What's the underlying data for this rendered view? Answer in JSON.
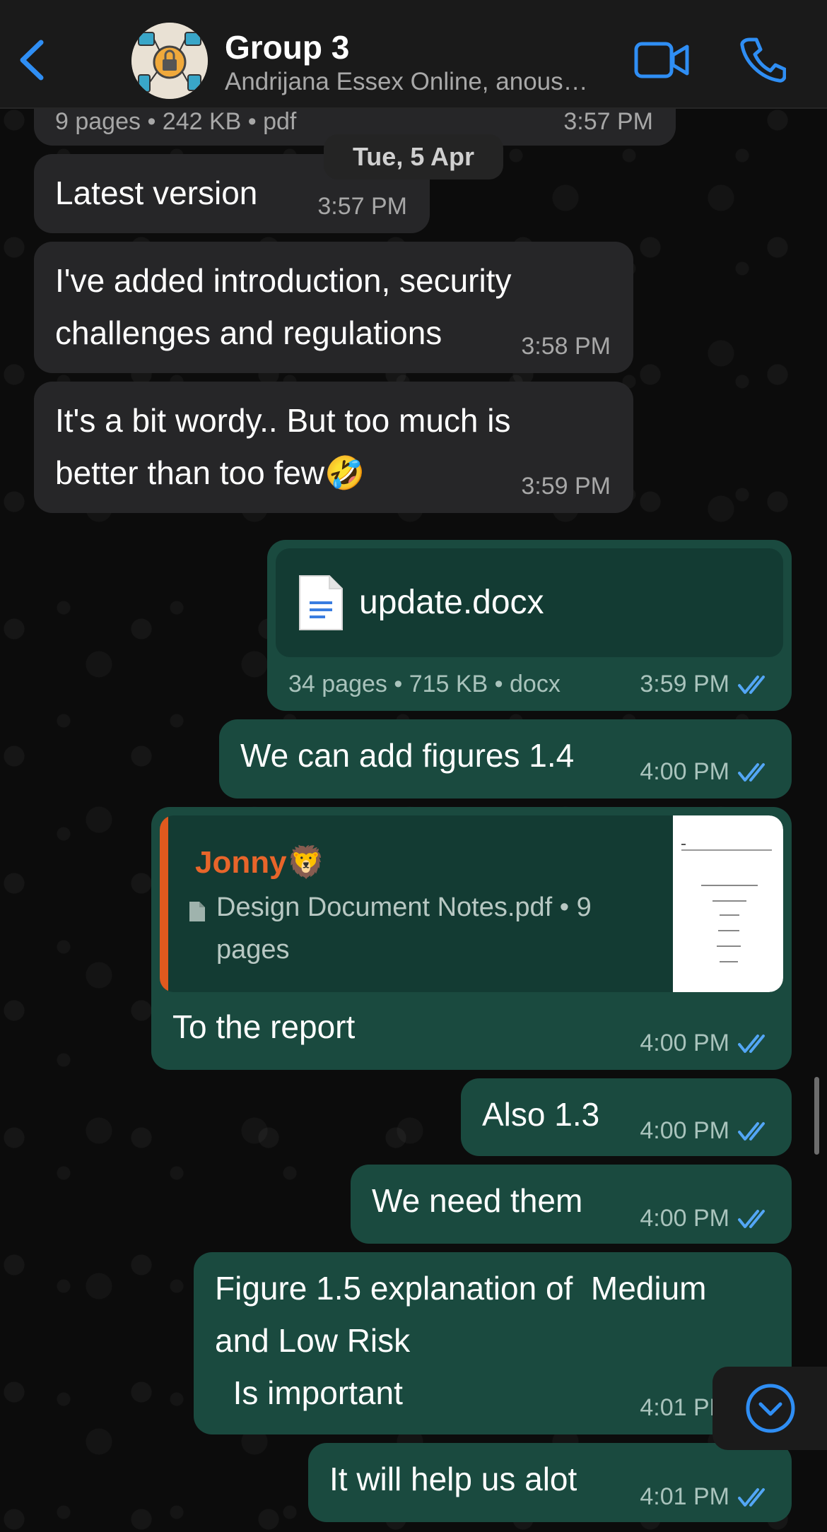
{
  "header": {
    "title": "Group 3",
    "subtitle": "Andrijana Essex Online, anous…"
  },
  "date_pill": "Tue, 5 Apr",
  "messages": {
    "m0": {
      "meta": "9 pages • 242 KB • pdf",
      "time": "3:57 PM"
    },
    "m1": {
      "text": "Latest version",
      "time": "3:57 PM"
    },
    "m2": {
      "text": "I've added introduction, security\nchallenges and regulations",
      "time": "3:58 PM"
    },
    "m3": {
      "text": "It's a bit wordy.. But too much is\nbetter than too few🤣",
      "time": "3:59 PM"
    },
    "m4": {
      "filename": "update.docx",
      "meta": "34 pages • 715 KB • docx",
      "time": "3:59 PM"
    },
    "m5": {
      "text": "We can add figures 1.4",
      "time": "4:00 PM"
    },
    "m6": {
      "quote_author": "Jonny🦁",
      "quote_doc": "Design Document Notes.pdf • 9 pages",
      "text": "To the report",
      "time": "4:00 PM"
    },
    "m7": {
      "text": "Also 1.3",
      "time": "4:00 PM"
    },
    "m8": {
      "text": "We need them",
      "time": "4:00 PM"
    },
    "m9": {
      "text": "Figure 1.5 explanation of  Medium\nand Low Risk\n  Is important",
      "time": "4:01 PM"
    },
    "m10": {
      "text": "It will help us alot",
      "time": "4:01 PM"
    }
  },
  "colors": {
    "accent": "#2f8ef4",
    "outgoing_bubble": "#1a4a3f",
    "incoming_bubble": "#262628",
    "quote_author": "#e8652a"
  },
  "icons": [
    "back-chevron-icon",
    "group-avatar",
    "video-call-icon",
    "phone-icon",
    "document-icon",
    "double-tick-icon",
    "scroll-down-icon"
  ]
}
